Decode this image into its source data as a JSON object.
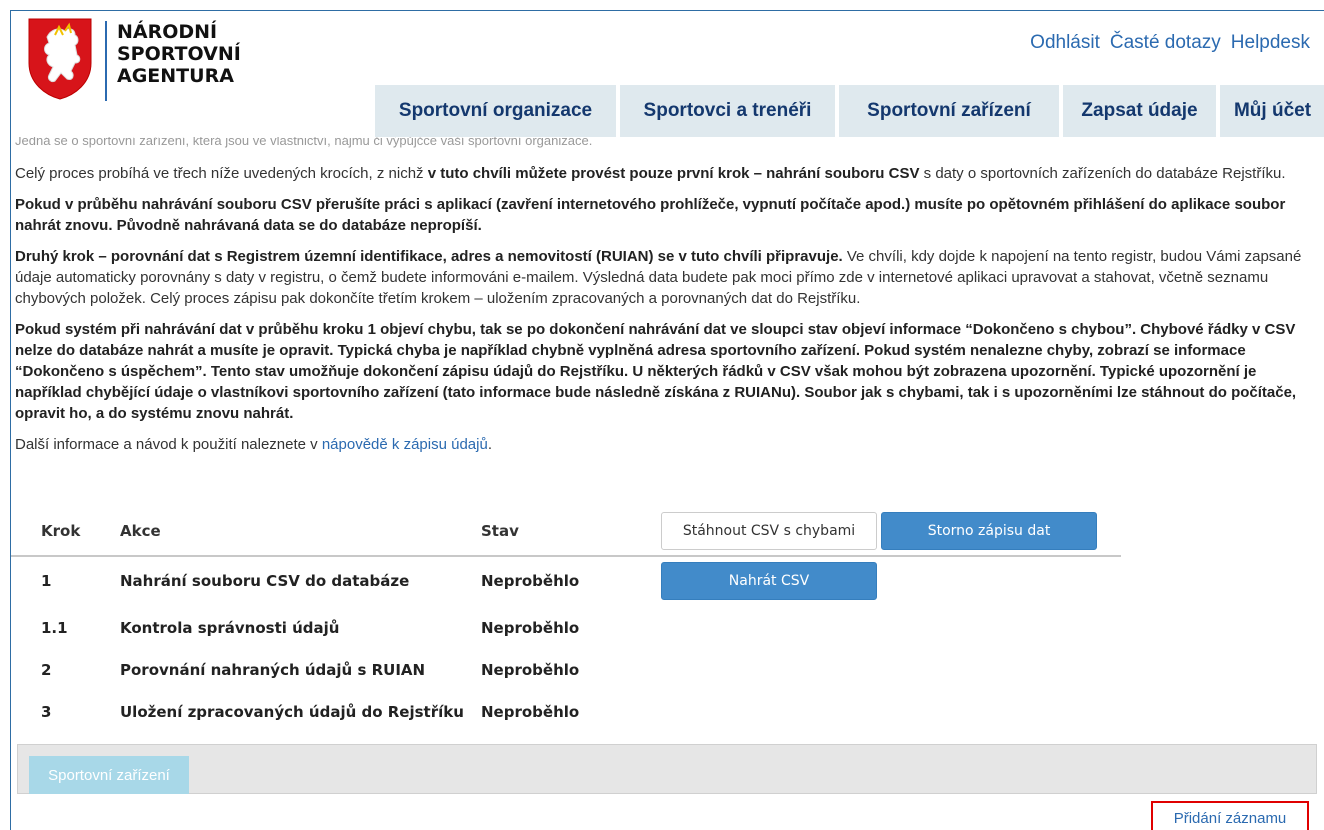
{
  "header": {
    "logo_lines": [
      "NÁRODNÍ",
      "SPORTOVNÍ",
      "AGENTURA"
    ],
    "links": [
      "Odhlásit",
      "Časté dotazy",
      "Helpdesk"
    ]
  },
  "nav": [
    "Sportovní organizace",
    "Sportovci a trenéři",
    "Sportovní zařízení",
    "Zapsat údaje",
    "Můj účet"
  ],
  "content": {
    "cut_text": "Jedná se o sportovní zařízení, která jsou ve vlastnictví, nájmu či výpůjčce vaší sportovní organizace.",
    "p1_pre": "Celý proces probíhá ve třech níže uvedených krocích, z nichž ",
    "p1_bold": "v tuto chvíli můžete provést pouze první krok – nahrání souboru CSV",
    "p1_post": " s daty o sportovních zařízeních do databáze Rejstříku.",
    "p2_bold": "Pokud v průběhu nahrávání souboru CSV přerušíte práci s aplikací (zavření internetového prohlížeče, vypnutí počítače apod.) musíte po opětovném přihlášení do aplikace soubor nahrát znovu. Původně nahrávaná data se do databáze nepropíší.",
    "p3_bold": "Druhý krok – porovnání dat s Registrem územní identifikace, adres a nemovitostí (RUIAN) se v tuto chvíli připravuje.",
    "p3_post": " Ve chvíli, kdy dojde k napojení na tento registr, budou Vámi zapsané údaje automaticky porovnány s daty v registru, o čemž budete informováni e-mailem. Výsledná data budete pak moci přímo zde v internetové aplikaci upravovat a stahovat, včetně seznamu chybových položek. Celý proces zápisu pak dokončíte třetím krokem – uložením zpracovaných a porovnaných dat do Rejstříku.",
    "p4_bold": "Pokud systém při nahrávání dat v průběhu kroku 1 objeví chybu, tak se po dokončení nahrávání dat ve sloupci stav objeví informace “Dokončeno s chybou”. Chybové řádky v CSV nelze do databáze nahrát a musíte je opravit. Typická chyba je například chybně vyplněná adresa sportovního zařízení. Pokud systém nenalezne chyby, zobrazí se informace “Dokončeno s úspěchem”. Tento stav umožňuje dokončení zápisu údajů do Rejstříku. U některých řádků v CSV však mohou být zobrazena upozornění. Typické upozornění je například chybějící údaje o vlastníkovi sportovního zařízení (tato informace bude následně získána z RUIANu). Soubor jak s chybami, tak i s upozorněními lze stáhnout do počítače, opravit ho, a do systému znovu nahrát.",
    "p5_pre": "Další informace a návod k použití naleznete v ",
    "p5_link": "nápovědě k zápisu údajů",
    "p5_post": "."
  },
  "steps": {
    "headers": {
      "krok": "Krok",
      "akce": "Akce",
      "stav": "Stav"
    },
    "download_btn": "Stáhnout CSV s chybami",
    "storno_btn": "Storno zápisu dat",
    "upload_btn": "Nahrát CSV",
    "rows": [
      {
        "krok": "1",
        "akce": "Nahrání souboru CSV do databáze",
        "stav": "Neproběhlo"
      },
      {
        "krok": "1.1",
        "akce": "Kontrola správnosti údajů",
        "stav": "Neproběhlo"
      },
      {
        "krok": "2",
        "akce": "Porovnání nahraných údajů s RUIAN",
        "stav": "Neproběhlo"
      },
      {
        "krok": "3",
        "akce": "Uložení zpracovaných údajů do Rejstříku",
        "stav": "Neproběhlo"
      }
    ]
  },
  "panel": {
    "tab": "Sportovní zařízení",
    "add_link": "Přidání záznamu"
  }
}
